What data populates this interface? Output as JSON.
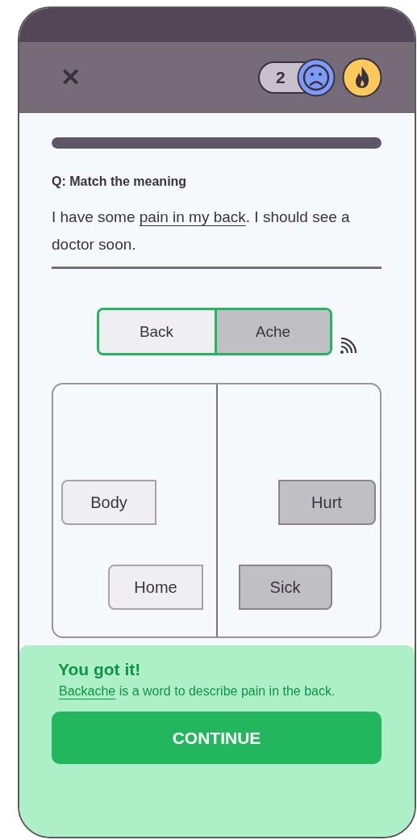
{
  "header": {
    "close_icon": "✕",
    "mistakes_count": "2"
  },
  "progress": {
    "level": 1
  },
  "question": {
    "label": "Q: Match the meaning",
    "sentence_before": "I have some ",
    "sentence_highlight": "pain in my back",
    "sentence_after": ". I should see a doctor soon."
  },
  "pair": {
    "matched": true,
    "words": [
      {
        "label": "Back",
        "kind": "left"
      },
      {
        "label": "Ache",
        "kind": "right"
      }
    ]
  },
  "board": {
    "words": [
      {
        "label": "Body",
        "kind": "left"
      },
      {
        "label": "Home",
        "kind": "left"
      },
      {
        "label": "Hurt",
        "kind": "right"
      },
      {
        "label": "Sick",
        "kind": "right"
      }
    ]
  },
  "feedback": {
    "correct": true,
    "title": "You got it!",
    "highlight": "Backache",
    "text": " is a word to describe pain in the back.",
    "button": "CONTINUE"
  }
}
